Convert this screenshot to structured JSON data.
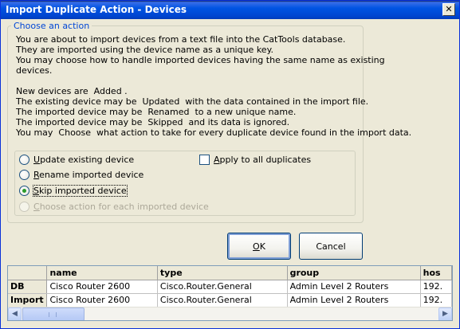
{
  "window": {
    "title": "Import Duplicate Action - Devices",
    "close_glyph": "✕"
  },
  "groupbox": {
    "title": "Choose an action",
    "lines": [
      "You are about to import devices from a text file into the CatTools database.",
      "They are imported using the device name as a unique key.",
      "You may choose how to handle imported devices having the same name as existing",
      "devices.",
      "",
      "New devices are  Added .",
      "The existing device may be  Updated  with the data contained in the import file.",
      "The imported device may be  Renamed  to a new unique name.",
      "The imported device may be  Skipped  and its data is ignored.",
      "You may  Choose  what action to take for every duplicate device found in the import data."
    ]
  },
  "options": {
    "update": {
      "accel": "U",
      "rest": "pdate  existing device",
      "checked": false,
      "enabled": true
    },
    "rename": {
      "accel": "R",
      "rest": "ename  imported device",
      "checked": false,
      "enabled": true
    },
    "skip": {
      "accel": "S",
      "rest": "kip imported device",
      "checked": true,
      "enabled": true
    },
    "choose": {
      "accel": "C",
      "rest": "hoose  action for each imported device",
      "checked": false,
      "enabled": false
    },
    "apply_all": {
      "accel": "A",
      "rest": "pply to all duplicates",
      "checked": false
    }
  },
  "buttons": {
    "ok": {
      "accel": "O",
      "rest": "K"
    },
    "cancel": {
      "label": "Cancel"
    }
  },
  "grid": {
    "columns": [
      "",
      "name",
      "type",
      "group",
      "hos"
    ],
    "rows": [
      {
        "header": "DB",
        "cells": [
          "Cisco Router 2600",
          "Cisco.Router.General",
          "Admin Level 2 Routers",
          "192."
        ]
      },
      {
        "header": "Import",
        "cells": [
          "Cisco Router 2600",
          "Cisco.Router.General",
          "Admin Level 2 Routers",
          "192."
        ]
      }
    ],
    "scroll_left_glyph": "◀",
    "scroll_right_glyph": "▶"
  }
}
